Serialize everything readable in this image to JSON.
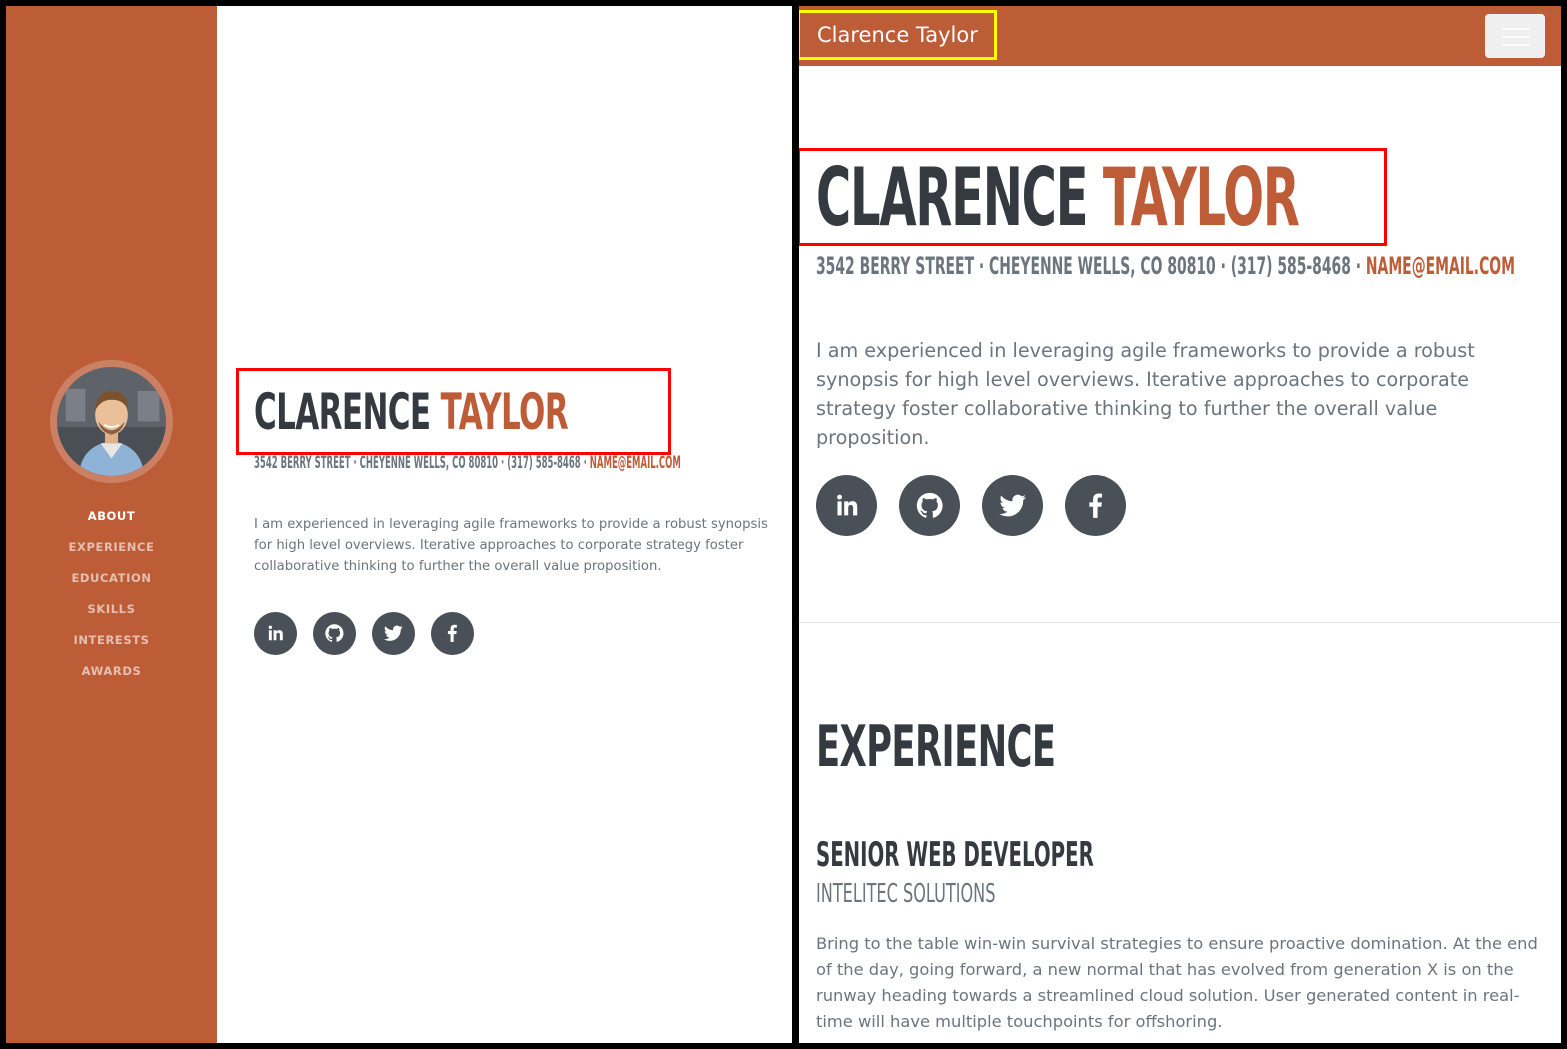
{
  "profile": {
    "first_name": "CLARENCE",
    "last_name": "TAYLOR",
    "address": "3542 BERRY STREET · CHEYENNE WELLS, CO 80810 · (317) 585-8468 · ",
    "email": "NAME@EMAIL.COM",
    "lead": "I am experienced in leveraging agile frameworks to provide a robust synopsis for high level overviews. Iterative approaches to corporate strategy foster collaborative thinking to further the overall value proposition."
  },
  "sidebar": {
    "items": [
      {
        "label": "ABOUT",
        "active": true
      },
      {
        "label": "EXPERIENCE",
        "active": false
      },
      {
        "label": "EDUCATION",
        "active": false
      },
      {
        "label": "SKILLS",
        "active": false
      },
      {
        "label": "INTERESTS",
        "active": false
      },
      {
        "label": "AWARDS",
        "active": false
      }
    ]
  },
  "social": [
    {
      "icon": "linkedin-icon"
    },
    {
      "icon": "github-icon"
    },
    {
      "icon": "twitter-icon"
    },
    {
      "icon": "facebook-icon"
    }
  ],
  "navbar": {
    "brand": "Clarence Taylor",
    "toggler_icon": "hamburger-menu-icon"
  },
  "experience": {
    "section_title": "EXPERIENCE",
    "jobs": [
      {
        "title": "SENIOR WEB DEVELOPER",
        "company": "INTELITEC SOLUTIONS",
        "description": "Bring to the table win-win survival strategies to ensure proactive domination. At the end of the day, going forward, a new normal that has evolved from generation X is on the runway heading towards a streamlined cloud solution. User generated content in real-time will have multiple touchpoints for offshoring."
      }
    ]
  },
  "colors": {
    "primary": "#bd5d38",
    "dark": "#343a40",
    "muted": "#6c757d",
    "social_bg": "#495057",
    "highlight_red": "#ff0000",
    "highlight_yellow": "#ffff00"
  }
}
